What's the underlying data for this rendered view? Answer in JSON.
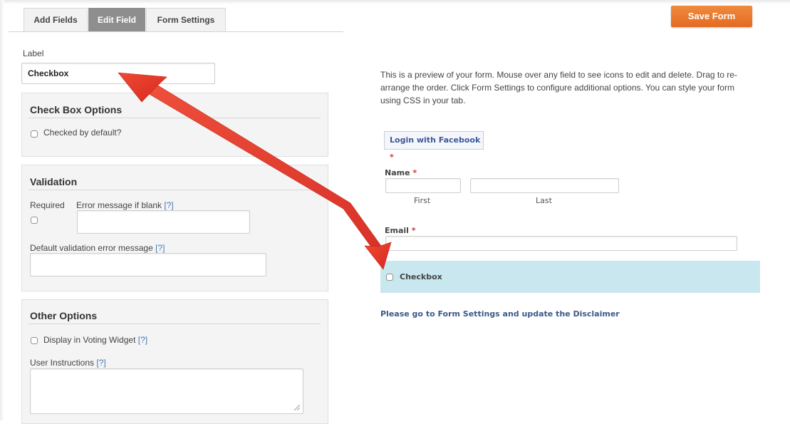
{
  "tabs": [
    {
      "label": "Add Fields"
    },
    {
      "label": "Edit Field"
    },
    {
      "label": "Form Settings"
    }
  ],
  "save_button": "Save Form",
  "edit_panel": {
    "label_caption": "Label",
    "label_value": "Checkbox",
    "checkbox_options": {
      "title": "Check Box Options",
      "checked_default": "Checked by default?"
    },
    "validation": {
      "title": "Validation",
      "required": "Required",
      "error_blank": "Error message if blank",
      "default_error": "Default validation error message",
      "help": "[?]"
    },
    "other_options": {
      "title": "Other Options",
      "voting_widget": "Display in Voting Widget",
      "user_instructions": "User Instructions",
      "help": "[?]"
    }
  },
  "preview": {
    "intro": "This is a preview of your form. Mouse over any field to see icons to edit and delete. Drag to re-arrange the order. Click Form Settings to configure additional options. You can style your form using CSS in your tab.",
    "facebook_button": "Login with Facebook",
    "required_mark": "*",
    "name_label": "Name",
    "first_sub": "First",
    "last_sub": "Last",
    "email_label": "Email",
    "checkbox_label": "Checkbox",
    "disclaimer": "Please go to Form Settings and update the Disclaimer"
  },
  "colors": {
    "accent_orange": "#e8772c",
    "highlight": "#c9e7ef",
    "arrow_red": "#e0362b",
    "link_blue": "#3b5a8a"
  }
}
